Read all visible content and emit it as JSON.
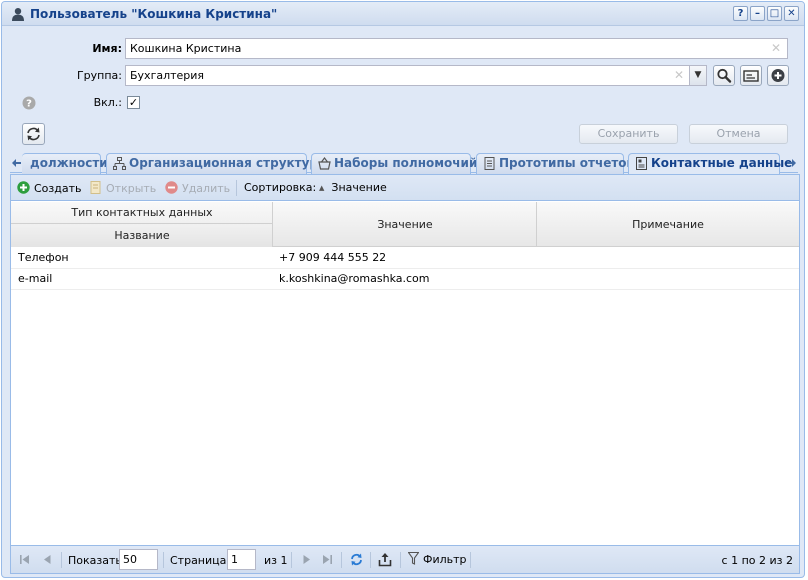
{
  "window": {
    "title": "Пользователь \"Кошкина Кристина\"",
    "buttons": [
      "?",
      "–",
      "□",
      "✕"
    ]
  },
  "form": {
    "name_label": "Имя:",
    "name_value": "Кошкина Кристина",
    "group_label": "Группа:",
    "group_value": "Бухгалтерия",
    "enabled_label": "Вкл.:",
    "enabled_checked": true,
    "save_label": "Сохранить",
    "cancel_label": "Отмена"
  },
  "tabs": [
    {
      "label": "должности",
      "active": false
    },
    {
      "label": "Организационная структура",
      "active": false
    },
    {
      "label": "Наборы полномочий",
      "active": false
    },
    {
      "label": "Прототипы отчетов",
      "active": false
    },
    {
      "label": "Контактные данные",
      "active": true
    }
  ],
  "toolbar": {
    "create_label": "Создать",
    "open_label": "Открыть",
    "delete_label": "Удалить",
    "sort_label": "Сортировка:",
    "sort_value": "Значение"
  },
  "grid": {
    "group_header": "Тип контактных данных",
    "col_name": "Название",
    "col_value": "Значение",
    "col_note": "Примечание",
    "rows": [
      {
        "name": "Телефон",
        "value": "+7 909 444 555 22",
        "note": ""
      },
      {
        "name": "e-mail",
        "value": "k.koshkina@romashka.com",
        "note": ""
      }
    ]
  },
  "pager": {
    "show_label": "Показать",
    "page_size": "50",
    "page_label": "Страница",
    "page_value": "1",
    "of_label": "из 1",
    "filter_label": "Фильтр",
    "summary": "с 1 по 2 из 2"
  },
  "colors": {
    "accent": "#15428b",
    "border": "#99bbe8",
    "background": "#dfe8f6",
    "create_icon": "#2e9e3e",
    "delete_icon": "#e08a8a"
  }
}
